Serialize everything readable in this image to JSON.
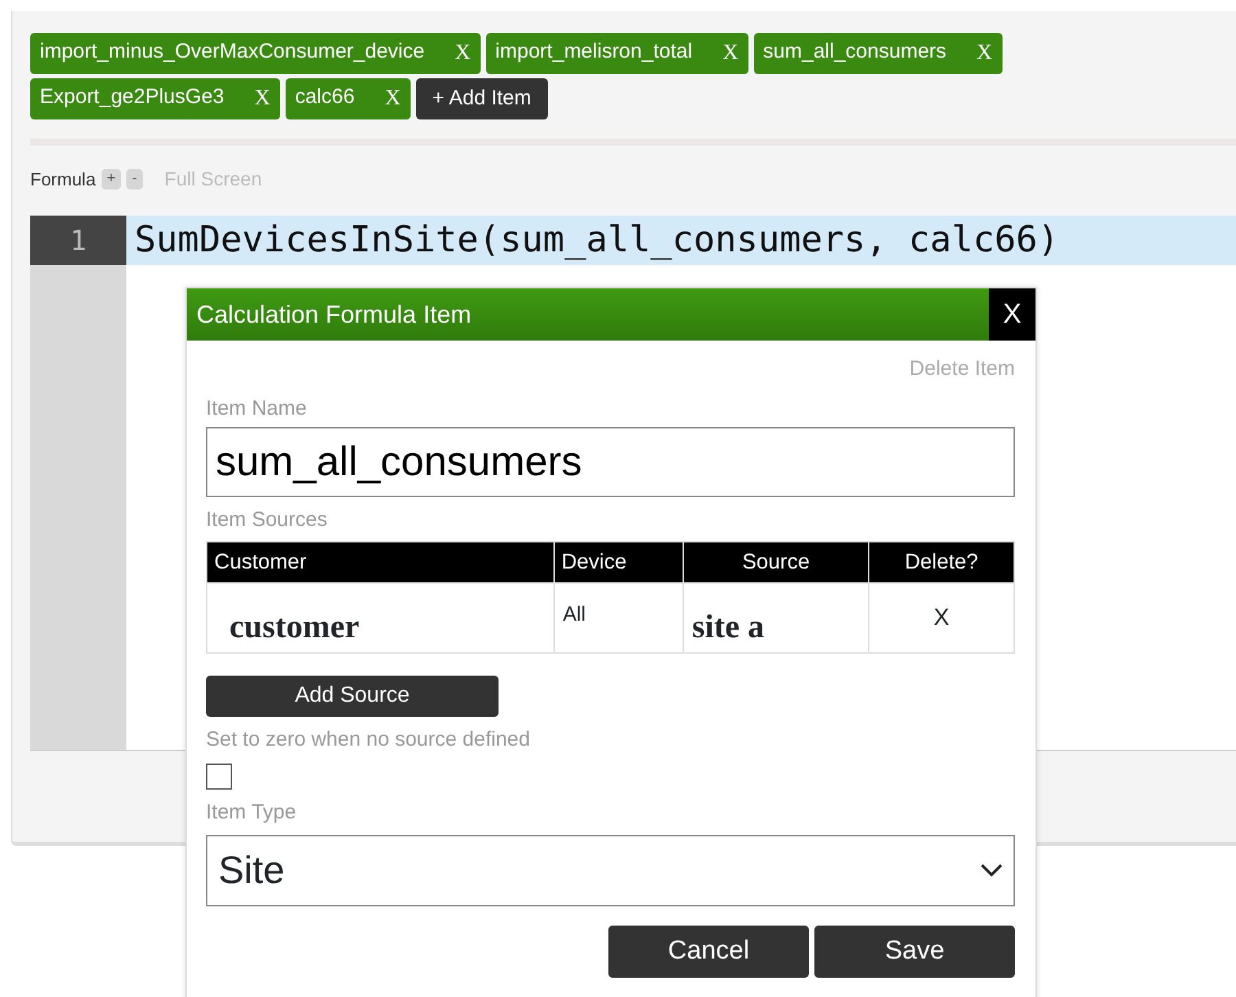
{
  "tags": [
    {
      "label": "import_minus_OverMaxConsumer_device",
      "remove": "X"
    },
    {
      "label": "import_melisron_total",
      "remove": "X"
    },
    {
      "label": "sum_all_consumers",
      "remove": "X"
    },
    {
      "label": "Export_ge2PlusGe3",
      "remove": "X"
    },
    {
      "label": "calc66",
      "remove": "X"
    }
  ],
  "add_item": "+ Add Item",
  "formula": {
    "label": "Formula",
    "zoom_in": "+",
    "zoom_out": "-",
    "full_screen": "Full Screen"
  },
  "editor": {
    "lines": [
      {
        "number": "1",
        "code": "SumDevicesInSite(sum_all_consumers, calc66)"
      }
    ]
  },
  "dialog": {
    "title": "Calculation Formula Item",
    "close": "X",
    "delete_item": "Delete Item",
    "item_name": {
      "label": "Item Name",
      "value": "sum_all_consumers"
    },
    "sources": {
      "label": "Item Sources",
      "columns": [
        "Customer",
        "Device",
        "Source",
        "Delete?"
      ],
      "rows": [
        [
          "customer",
          "All",
          "site a",
          "X"
        ]
      ]
    },
    "add_source": "Add Source",
    "zero": {
      "label": "Set to zero when no source defined",
      "checked": false
    },
    "item_type": {
      "label": "Item Type",
      "value": "Site"
    },
    "buttons": [
      "Cancel",
      "Save"
    ]
  }
}
